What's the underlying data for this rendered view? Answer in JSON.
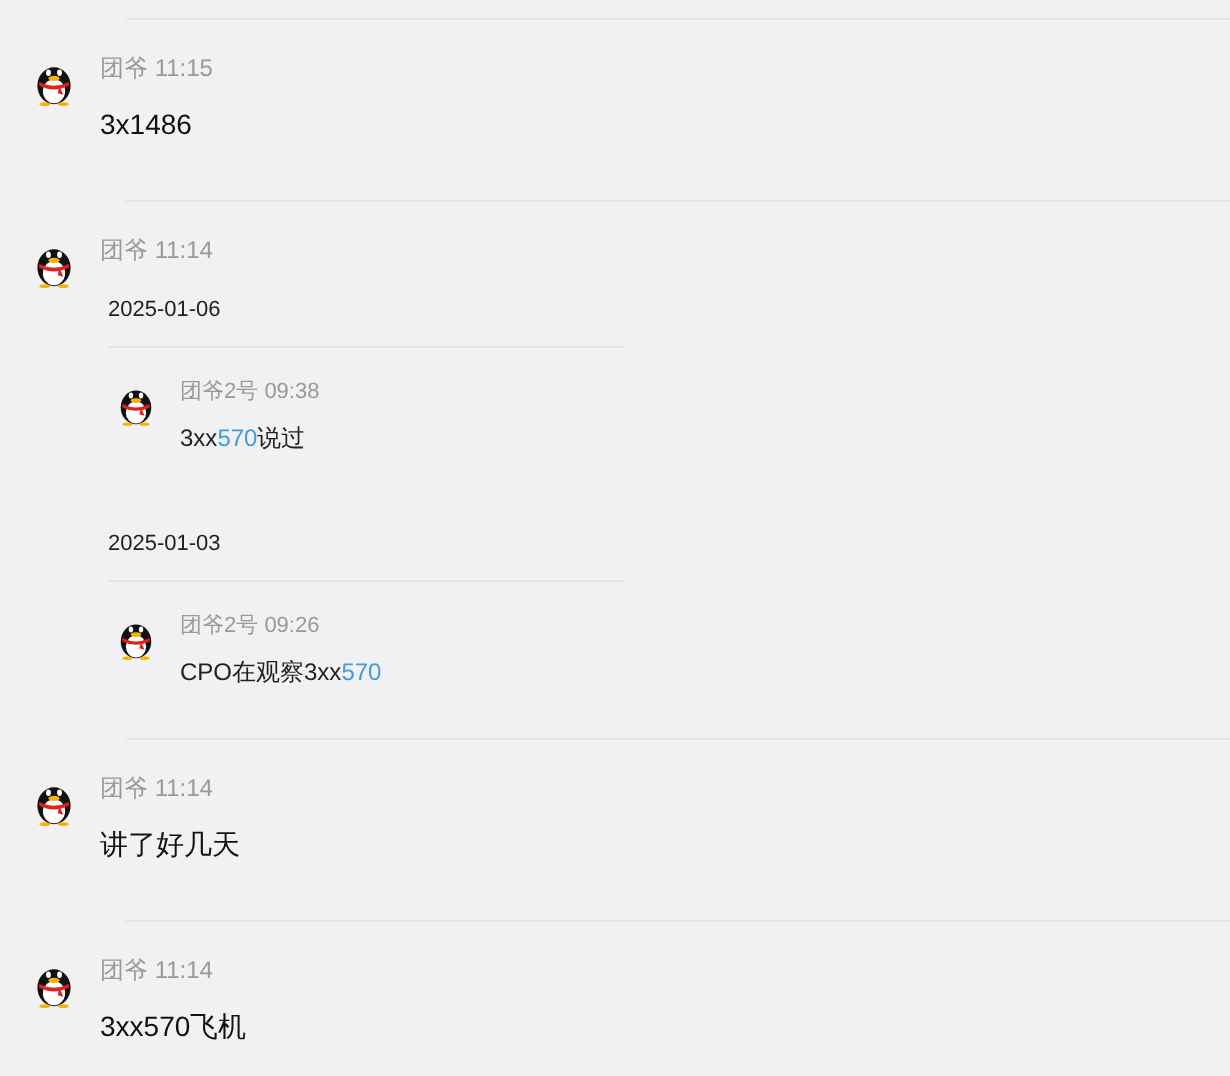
{
  "messages": [
    {
      "sender": "团爷",
      "time": "11:15",
      "body": [
        {
          "text": "3x1486",
          "highlight": false
        }
      ]
    },
    {
      "sender": "团爷",
      "time": "11:14",
      "forwarded": [
        {
          "date": "2025-01-06",
          "sender": "团爷2号",
          "time": "09:38",
          "body": [
            {
              "text": "3xx",
              "highlight": false
            },
            {
              "text": "570",
              "highlight": true
            },
            {
              "text": "说过",
              "highlight": false
            }
          ]
        },
        {
          "date": "2025-01-03",
          "sender": "团爷2号",
          "time": "09:26",
          "body": [
            {
              "text": "CPO在观察3xx",
              "highlight": false
            },
            {
              "text": "570",
              "highlight": true
            }
          ]
        }
      ]
    },
    {
      "sender": "团爷",
      "time": "11:14",
      "body": [
        {
          "text": "讲了好几天",
          "highlight": false
        }
      ]
    },
    {
      "sender": "团爷",
      "time": "11:14",
      "body": [
        {
          "text": "3xx570飞机",
          "highlight": false
        }
      ]
    }
  ]
}
